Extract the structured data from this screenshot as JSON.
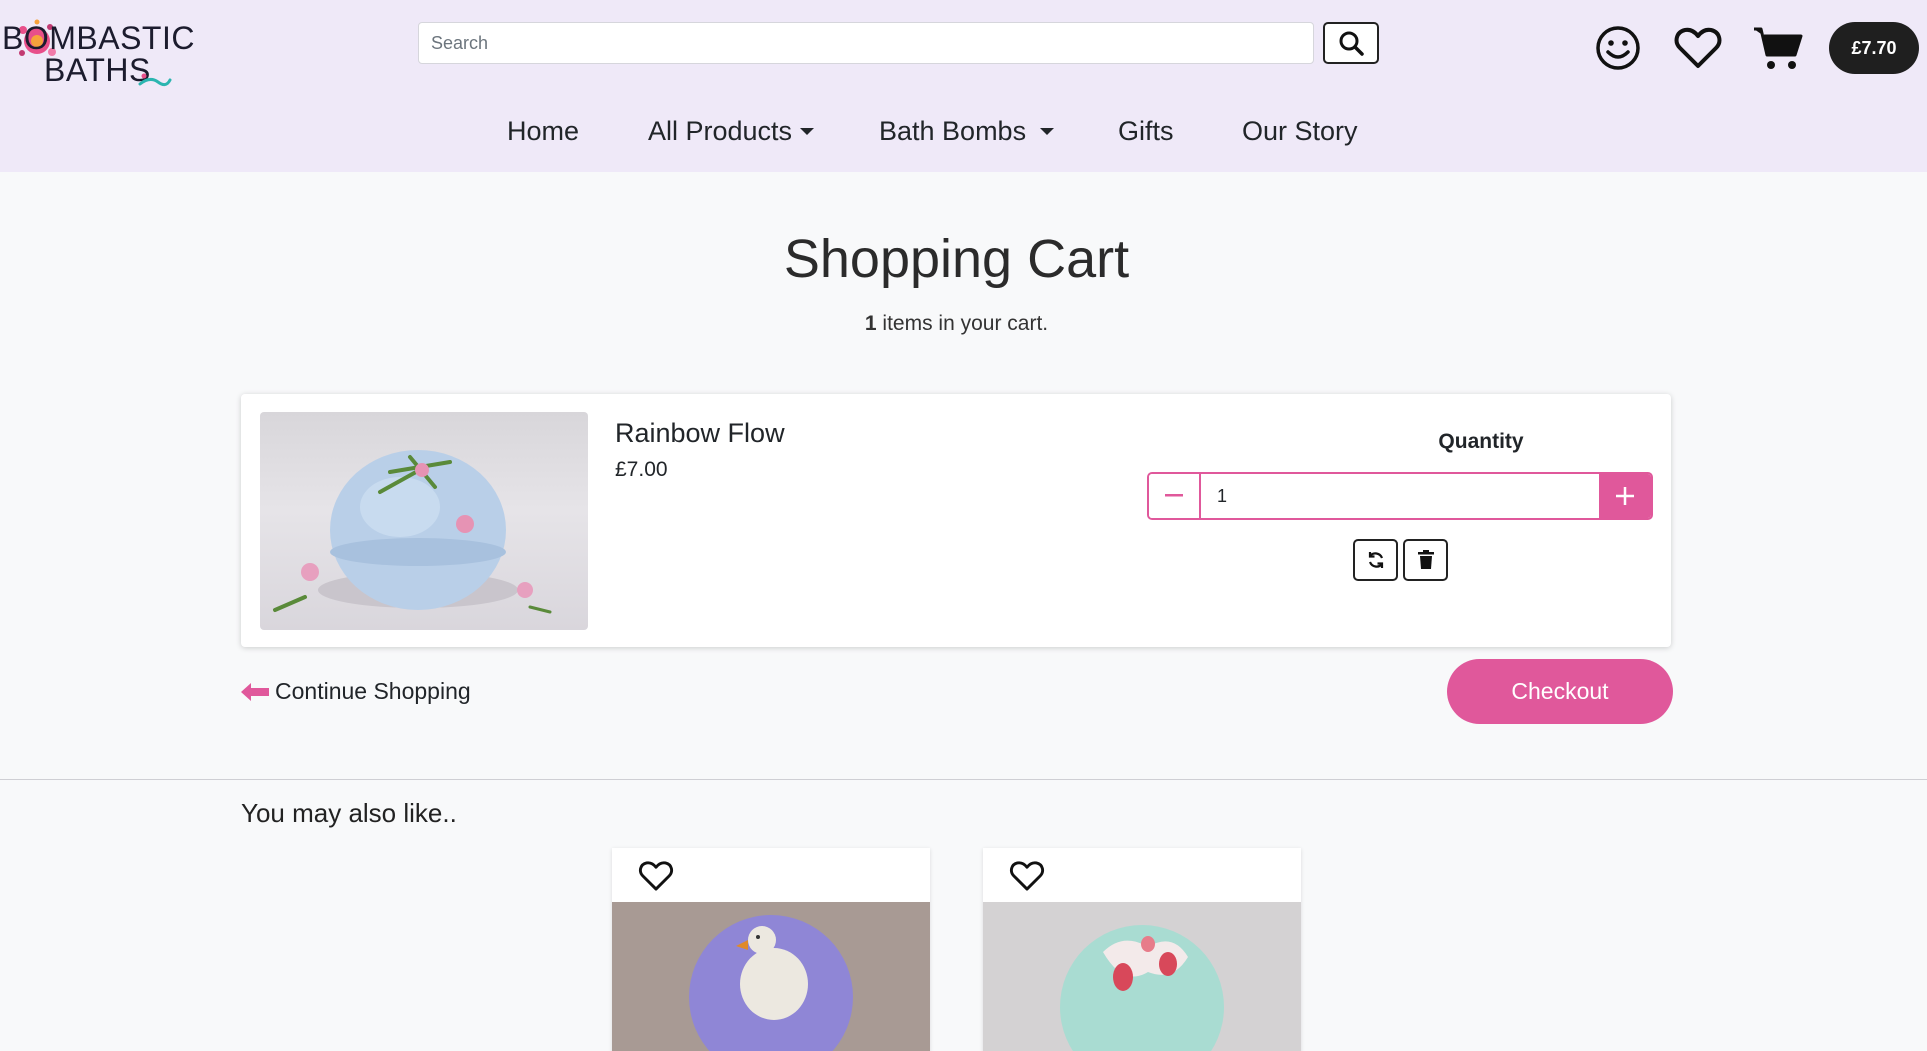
{
  "brand": {
    "line1": "BOMBASTIC",
    "line2": "BATHS"
  },
  "search": {
    "placeholder": "Search"
  },
  "header": {
    "cart_total": "£7.70"
  },
  "nav": {
    "items": [
      {
        "label": "Home"
      },
      {
        "label": "All Products"
      },
      {
        "label": "Bath Bombs"
      },
      {
        "label": "Gifts"
      },
      {
        "label": "Our Story"
      }
    ]
  },
  "cart": {
    "title": "Shopping Cart",
    "count": "1",
    "count_suffix": " items in your cart.",
    "item": {
      "name": "Rainbow Flow",
      "price": "£7.00",
      "quantity_label": "Quantity",
      "quantity": "1"
    },
    "continue_label": "Continue Shopping",
    "checkout_label": "Checkout"
  },
  "recommendations": {
    "heading": "You may also like.."
  },
  "colors": {
    "accent": "#e0589b",
    "header_bg": "#efe9f8",
    "dark": "#1f1f1f"
  },
  "icons": [
    "search-icon",
    "account-smiley-icon",
    "heart-icon",
    "cart-icon",
    "minus-icon",
    "plus-icon",
    "refresh-icon",
    "trash-icon",
    "arrow-left-icon"
  ]
}
